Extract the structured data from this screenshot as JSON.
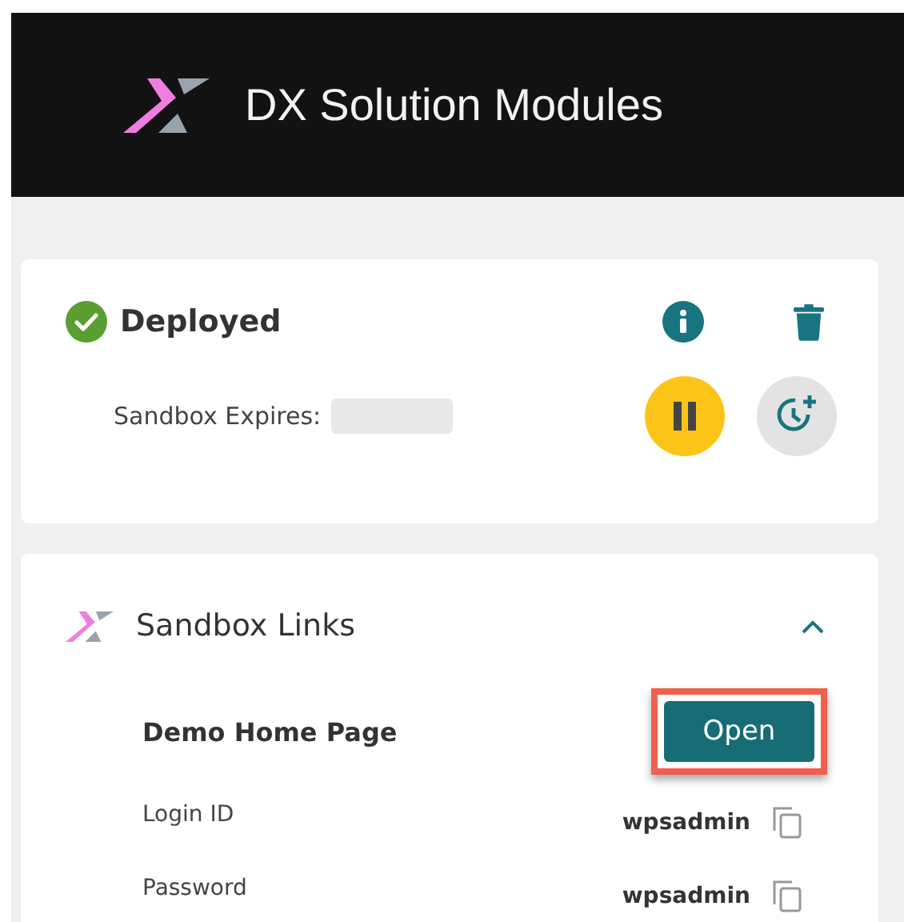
{
  "header": {
    "title": "DX Solution Modules"
  },
  "status_card": {
    "status": "Deployed",
    "expires_label": "Sandbox Expires:",
    "paused": false
  },
  "links_card": {
    "title": "Sandbox Links",
    "expanded": true,
    "links": [
      {
        "name": "Demo Home Page",
        "button": "Open",
        "highlighted": true
      }
    ],
    "credentials": [
      {
        "label": "Login ID",
        "value": "wpsadmin"
      },
      {
        "label": "Password",
        "value": "wpsadmin"
      }
    ]
  }
}
